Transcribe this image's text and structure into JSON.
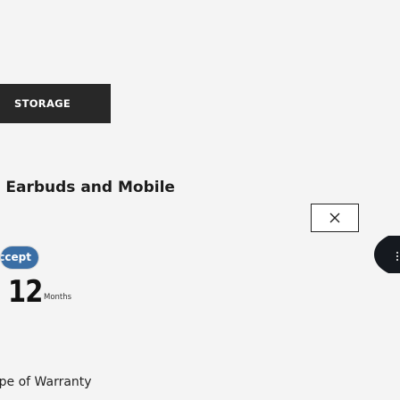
{
  "header": {
    "storage_tab_label": "STORAGE"
  },
  "title": "Earbuds and Mobile",
  "modal": {
    "close_icon": "close-icon"
  },
  "accept_button": {
    "label": "Accept"
  },
  "slider": {
    "nav_icon": "chevron-left-icon"
  },
  "warranty": {
    "value": "12",
    "unit": "Months",
    "label": "Type of Warranty"
  }
}
